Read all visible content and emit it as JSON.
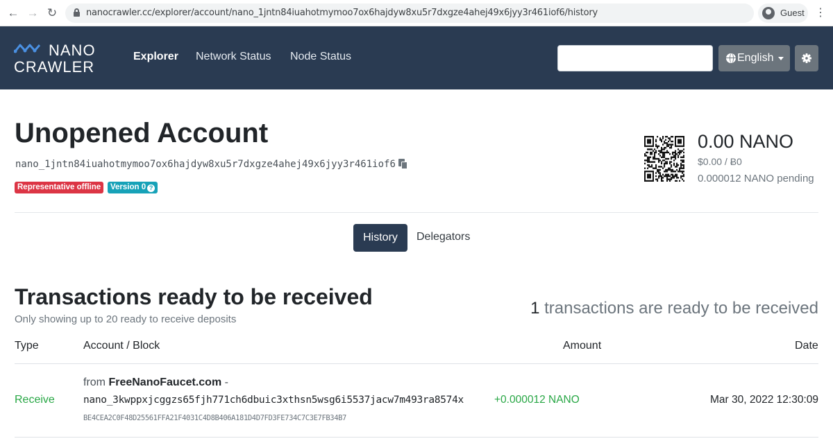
{
  "browser": {
    "url": "nanocrawler.cc/explorer/account/nano_1jntn84iuahotmymoo7ox6hajdyw8xu5r7dxgze4ahej49x6jyy3r461iof6/history",
    "profile_label": "Guest"
  },
  "navbar": {
    "logo_top": "NANO",
    "logo_bottom": "CRAWLER",
    "links": [
      {
        "label": "Explorer",
        "active": true
      },
      {
        "label": "Network Status",
        "active": false
      },
      {
        "label": "Node Status",
        "active": false
      }
    ],
    "search_placeholder": "",
    "language_label": "English"
  },
  "account": {
    "title": "Unopened Account",
    "address": "nano_1jntn84iuahotmymoo7ox6hajdyw8xu5r7dxgze4ahej49x6jyy3r461iof6",
    "badges": [
      {
        "label": "Representative offline",
        "color": "#dc3545"
      },
      {
        "label": "Version 0",
        "color": "#17a2b8"
      }
    ],
    "balance": "0.00 NANO",
    "balance_fiat": "$0.00 / Ƀ0",
    "pending": "0.000012 NANO pending"
  },
  "tabs": [
    {
      "label": "History",
      "active": true
    },
    {
      "label": "Delegators",
      "active": false
    }
  ],
  "pending_section": {
    "title": "Transactions ready to be received",
    "subtitle": "Only showing up to 20 ready to receive deposits",
    "count": "1",
    "count_suffix": " transactions are ready to be received",
    "columns": [
      "Type",
      "Account / Block",
      "Amount",
      "Date"
    ],
    "rows": [
      {
        "type": "Receive",
        "from_prefix": "from ",
        "from_name": "FreeNanoFaucet.com",
        "from_suffix": " -",
        "account": "nano_3kwppxjcggzs65fjh771ch6dbuic3xthsn5wsg6i5537jacw7m493ra8574x",
        "block": "BE4CEA2C0F48D25561FFA21F4031C4D8B406A181D4D7FD3FE734C7C3E7FB34B7",
        "amount": "+0.000012 NANO",
        "date": "Mar 30, 2022 12:30:09"
      }
    ]
  },
  "colors": {
    "navbar": "#2a3b52",
    "accent_green": "#28a745",
    "badge_red": "#dc3545",
    "badge_teal": "#17a2b8"
  }
}
